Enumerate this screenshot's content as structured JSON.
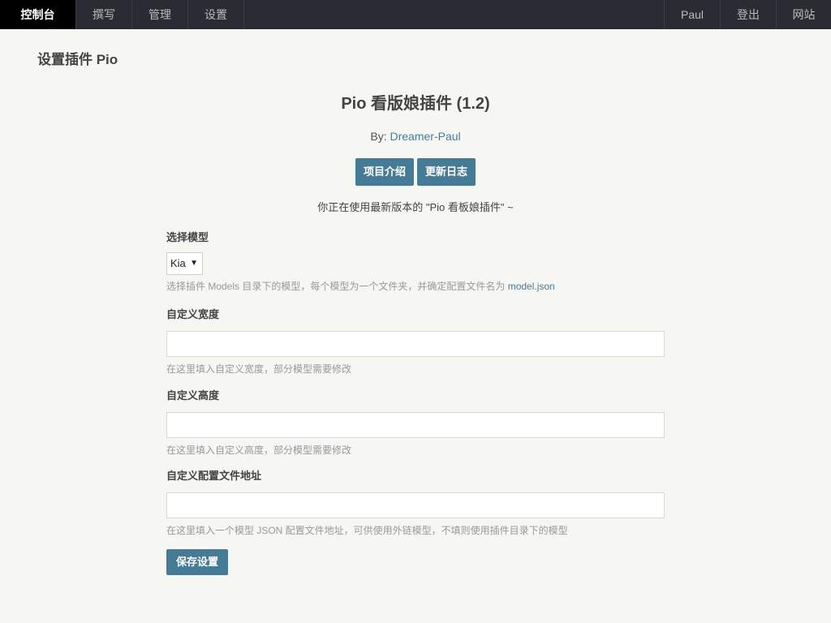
{
  "nav": {
    "left": [
      {
        "label": "控制台",
        "active": true
      },
      {
        "label": "撰写",
        "active": false
      },
      {
        "label": "管理",
        "active": false
      },
      {
        "label": "设置",
        "active": false
      }
    ],
    "right": [
      {
        "label": "Paul"
      },
      {
        "label": "登出"
      },
      {
        "label": "网站"
      }
    ]
  },
  "page": {
    "title": "设置插件 Pio"
  },
  "plugin": {
    "title": "Pio 看版娘插件 (1.2)",
    "by_prefix": "By: ",
    "author": "Dreamer-Paul",
    "buttons": [
      "项目介绍",
      "更新日志"
    ],
    "notice": "你正在使用最新版本的 \"Pio 看板娘插件\" ~"
  },
  "form": {
    "model": {
      "label": "选择模型",
      "value": "Kia",
      "desc": "选择插件 Models 目录下的模型，每个模型为一个文件夹，并确定配置文件名为 ",
      "desc_code": "model.json"
    },
    "width": {
      "label": "自定义宽度",
      "value": "",
      "desc": "在这里填入自定义宽度，部分模型需要修改"
    },
    "height": {
      "label": "自定义高度",
      "value": "",
      "desc": "在这里填入自定义高度，部分模型需要修改"
    },
    "config_url": {
      "label": "自定义配置文件地址",
      "value": "",
      "desc": "在这里填入一个模型 JSON 配置文件地址，可供使用外链模型，不填则使用插件目录下的模型"
    },
    "submit_label": "保存设置"
  },
  "colors": {
    "nav_bg": "#292d33",
    "nav_active_bg": "#000000",
    "page_bg": "#f6f6f3",
    "accent": "#467b96",
    "muted_text": "#999999"
  }
}
